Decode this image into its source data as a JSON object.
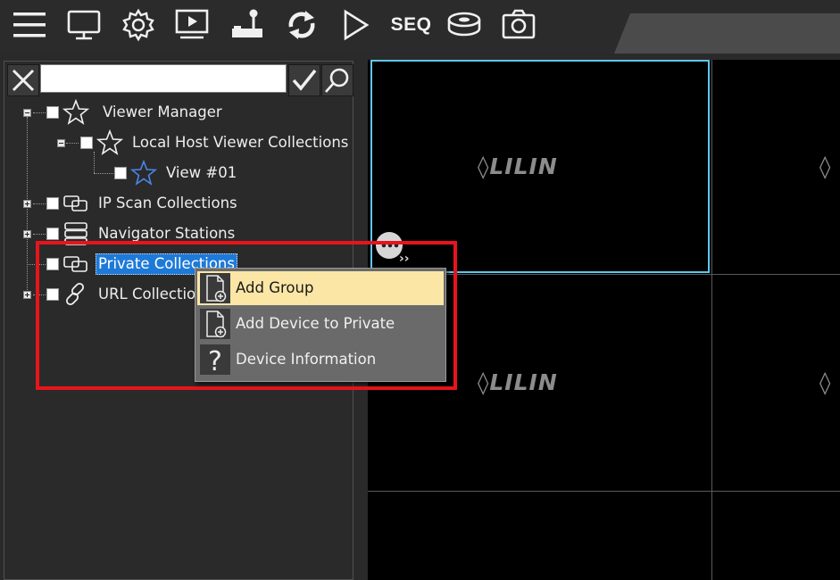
{
  "toolbar": {
    "icons": [
      "menu-icon",
      "monitor-icon",
      "settings-gear-icon",
      "playback-icon",
      "joystick-icon",
      "refresh-icon",
      "play-icon",
      "seq",
      "disk-icon",
      "camera-icon"
    ],
    "seq_label": "SEQ"
  },
  "search": {
    "value": "",
    "placeholder": ""
  },
  "tree": {
    "viewer_manager": "Viewer Manager",
    "local_host": "Local Host Viewer Collections",
    "view01": "View #01",
    "ip_scan": "IP Scan Collections",
    "navigator": "Navigator Stations",
    "private": "Private Collections",
    "url": "URL Collections"
  },
  "context_menu": {
    "items": [
      {
        "label": "Add Group",
        "icon": "add-file-icon",
        "highlighted": true
      },
      {
        "label": "Add Device to Private",
        "icon": "add-file-icon",
        "highlighted": false
      },
      {
        "label": "Device Information",
        "icon": "question-icon",
        "highlighted": false
      }
    ]
  },
  "video_grid": {
    "logo_text": "LILIN"
  },
  "colors": {
    "selected_cell_border": "#5bc8ee",
    "highlight_frame": "#e8141c",
    "tree_selection": "#1e7ad8",
    "menu_highlight": "#fbe6a6"
  }
}
